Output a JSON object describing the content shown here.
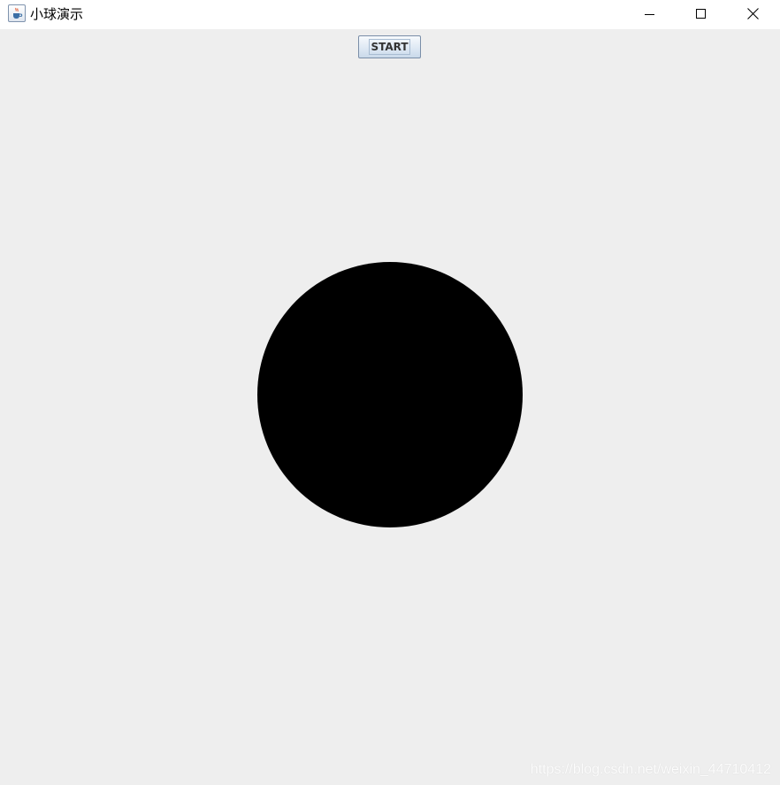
{
  "window": {
    "title": "小球演示",
    "icon": "java-cup-icon"
  },
  "controls": {
    "minimize": "minimize-icon",
    "maximize": "maximize-icon",
    "close": "close-icon"
  },
  "toolbar": {
    "start_label": "START"
  },
  "canvas": {
    "ball_color": "#000000",
    "background_color": "#eeeeee"
  },
  "watermark": {
    "text": "https://blog.csdn.net/weixin_44710412"
  }
}
